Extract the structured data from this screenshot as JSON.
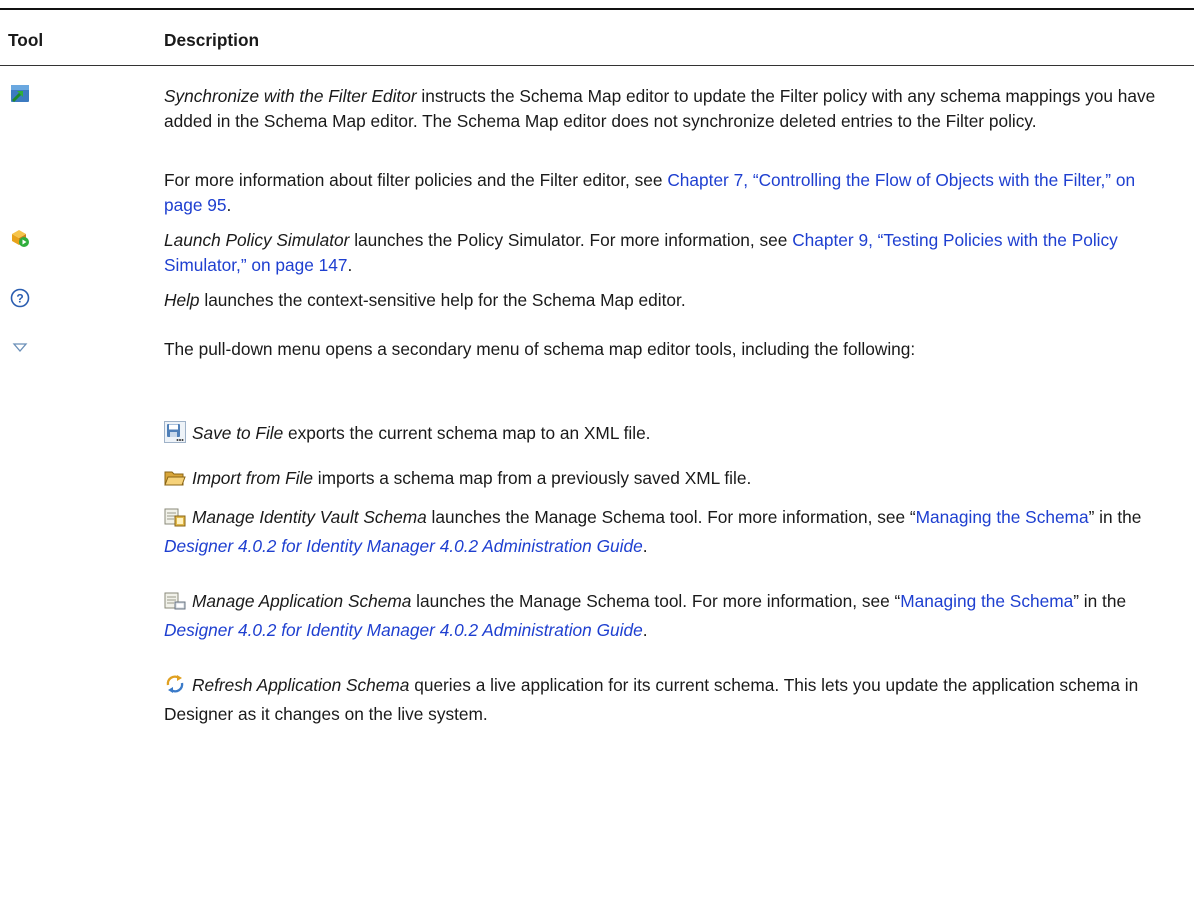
{
  "table": {
    "col_tool": "Tool",
    "col_description": "Description"
  },
  "rows": {
    "sync": {
      "icon": "synchronize-filter-icon",
      "italic": "Synchronize with the Filter Editor",
      "text": " instructs the Schema Map editor to update the Filter policy with any schema mappings you have added in the Schema Map editor. The Schema Map editor does not synchronize deleted entries to the Filter policy.",
      "more_prefix": "For more information about filter policies and the Filter editor, see ",
      "more_link": "Chapter 7, “Controlling the Flow of Objects with the Filter,” on page 95",
      "more_suffix": "."
    },
    "sim": {
      "icon": "launch-policy-simulator-icon",
      "italic": "Launch Policy Simulator",
      "text": " launches the Policy Simulator. For more information, see ",
      "link": "Chapter 9, “Testing Policies with the Policy Simulator,” on page 147",
      "suffix": "."
    },
    "help": {
      "icon": "help-icon",
      "italic": "Help",
      "text": " launches the context-sensitive help for the Schema Map editor."
    },
    "menu": {
      "icon": "pull-down-menu-icon",
      "text": "The pull-down menu opens a secondary menu of schema map editor tools, including the following:",
      "items": {
        "save": {
          "icon": "save-to-file-icon",
          "italic": "Save to File",
          "text": " exports the current schema map to an XML file."
        },
        "import": {
          "icon": "import-from-file-icon",
          "italic": "Import from File",
          "text": " imports a schema map from a previously saved XML file."
        },
        "vault": {
          "icon": "manage-identity-vault-schema-icon",
          "italic": "Manage Identity Vault Schema",
          "text": " launches the Manage Schema tool. For more information, see “",
          "link": "Managing the Schema",
          "mid": "” in the ",
          "guide": "Designer 4.0.2 for Identity Manager 4.0.2 Administration Guide",
          "suffix": "."
        },
        "app": {
          "icon": "manage-application-schema-icon",
          "italic": "Manage Application Schema",
          "text": " launches the Manage Schema tool. For more information, see “",
          "link": "Managing the Schema",
          "mid": "” in the ",
          "guide": "Designer 4.0.2 for Identity Manager 4.0.2 Administration Guide",
          "suffix": "."
        },
        "refresh": {
          "icon": "refresh-application-schema-icon",
          "italic": "Refresh Application Schema",
          "text": " queries a live application for its current schema. This lets you update the application schema in Designer as it changes on the live system."
        }
      }
    }
  }
}
